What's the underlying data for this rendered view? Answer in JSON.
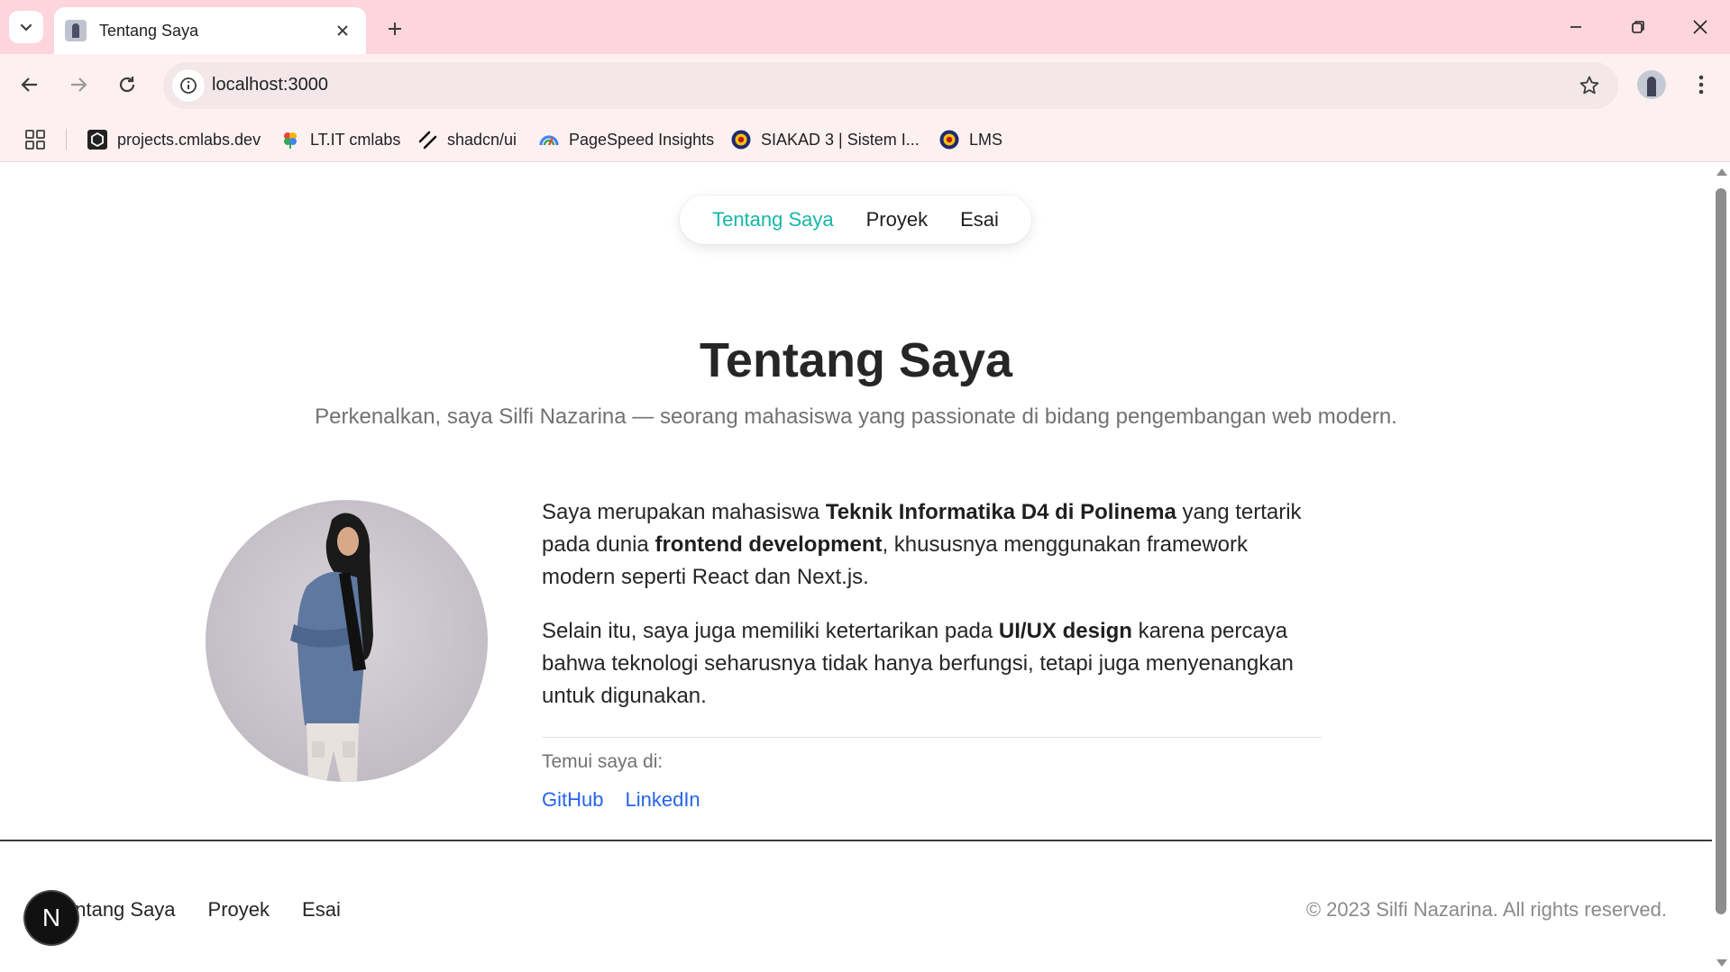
{
  "browser": {
    "tab_title": "Tentang Saya",
    "url": "localhost:3000",
    "bookmarks": [
      {
        "label": "projects.cmlabs.dev",
        "icon": "cmlabs-icon"
      },
      {
        "label": "LT.IT cmlabs",
        "icon": "cmlabs-flower-icon"
      },
      {
        "label": "shadcn/ui",
        "icon": "shadcn-icon"
      },
      {
        "label": "PageSpeed Insights",
        "icon": "pagespeed-icon"
      },
      {
        "label": "SIAKAD 3 | Sistem I...",
        "icon": "polinema-icon"
      },
      {
        "label": "LMS",
        "icon": "polinema-icon"
      }
    ]
  },
  "page": {
    "nav": {
      "items": [
        "Tentang Saya",
        "Proyek",
        "Esai"
      ],
      "active": "Tentang Saya"
    },
    "hero": {
      "title": "Tentang Saya",
      "subtitle": "Perkenalkan, saya Silfi Nazarina — seorang mahasiswa yang passionate di bidang pengembangan web modern."
    },
    "about": {
      "p1_a": "Saya merupakan mahasiswa ",
      "p1_b": "Teknik Informatika D4 di Polinema",
      "p1_c": " yang tertarik pada dunia ",
      "p1_d": "frontend development",
      "p1_e": ", khususnya menggunakan framework modern seperti React dan Next.js.",
      "p2_a": "Selain itu, saya juga memiliki ketertarikan pada ",
      "p2_b": "UI/UX design",
      "p2_c": " karena percaya bahwa teknologi seharusnya tidak hanya berfungsi, tetapi juga menyenangkan untuk digunakan."
    },
    "meet": {
      "label": "Temui saya di:",
      "links": [
        "GitHub",
        "LinkedIn"
      ]
    },
    "footer": {
      "nav": [
        "Tentang Saya",
        "Proyek",
        "Esai"
      ],
      "copyright": "© 2023 Silfi Nazarina. All rights reserved."
    },
    "dev_badge": "N"
  },
  "colors": {
    "accent": "#14b8a6",
    "link": "#2563eb",
    "chrome_bg": "#fdd5dc"
  }
}
